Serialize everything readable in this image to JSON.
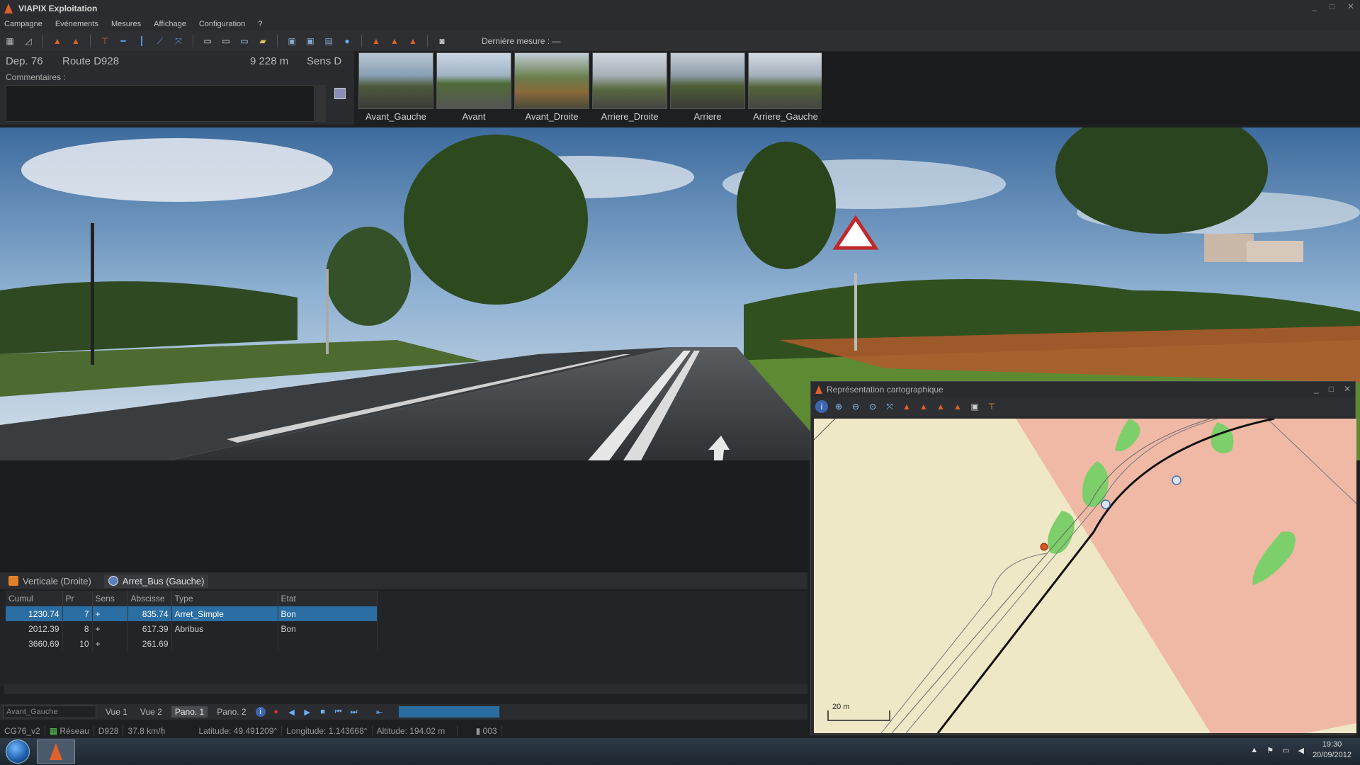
{
  "window": {
    "title": "VIAPIX Exploitation",
    "min": "_",
    "max": "□",
    "close": "✕"
  },
  "menu": [
    "Campagne",
    "Evénements",
    "Mesures",
    "Affichage",
    "Configuration",
    "?"
  ],
  "toolbar": {
    "derniere_mesure": "Dernière mesure : —"
  },
  "info": {
    "dep": "Dep. 76",
    "route": "Route D928",
    "distance": "9 228 m",
    "sens": "Sens D",
    "commentaires_label": "Commentaires :"
  },
  "thumbnails": [
    "Avant_Gauche",
    "Avant",
    "Avant_Droite",
    "Arriere_Droite",
    "Arriere",
    "Arriere_Gauche"
  ],
  "tabs": [
    "Verticale (Droite)",
    "Arret_Bus (Gauche)"
  ],
  "table": {
    "headers": [
      "Cumul",
      "Pr",
      "Sens",
      "Abscisse",
      "Type",
      "Etat"
    ],
    "rows": [
      [
        "1230.74",
        "7",
        "+",
        "835.74",
        "Arret_Simple",
        "Bon"
      ],
      [
        "2012.39",
        "8",
        "+",
        "617.39",
        "Abribus",
        "Bon"
      ],
      [
        "3660.69",
        "10",
        "+",
        "261.69",
        "",
        ""
      ]
    ]
  },
  "player": {
    "camera_select": "Avant_Gauche",
    "views": [
      "Vue 1",
      "Vue 2",
      "Pano. 1",
      "Pano. 2"
    ],
    "active_view": "Pano. 1"
  },
  "status": {
    "campaign": "CG76_v2",
    "network": "Réseau",
    "road": "D928",
    "speed": "37.8 km/h",
    "latitude": "Latitude: 49.491209°",
    "longitude": "Longitude: 1.143668°",
    "altitude": "Altitude: 194.02 m",
    "frame": "003"
  },
  "map_window": {
    "title": "Représentation cartographique",
    "scale_label": "20 m"
  },
  "taskbar": {
    "time": "19:30",
    "date": "20/09/2012"
  },
  "colors": {
    "accent": "#2b6ea3",
    "map_land": "#efe8c6",
    "map_zone": "#f0b9a6",
    "map_green": "#7ccf6a",
    "progress": "#2a6e9f"
  }
}
